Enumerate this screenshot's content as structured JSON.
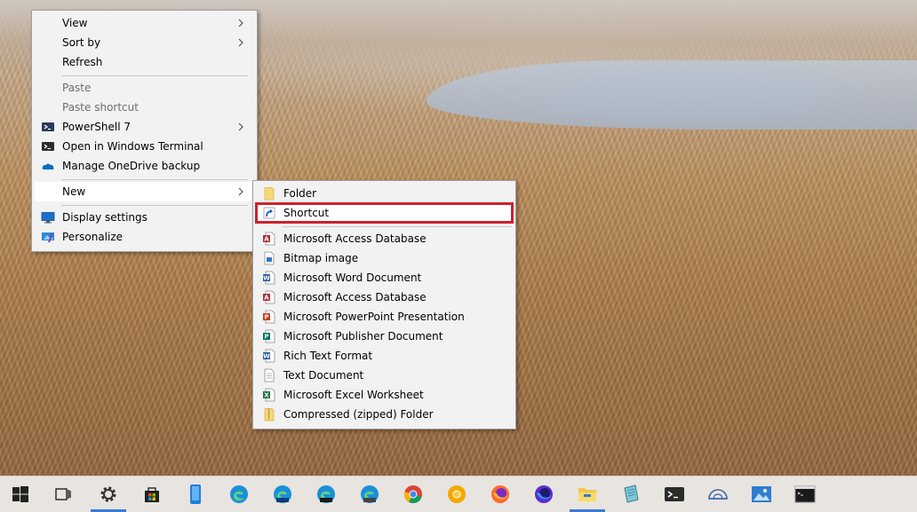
{
  "context_menu": {
    "view": "View",
    "sort_by": "Sort by",
    "refresh": "Refresh",
    "paste": "Paste",
    "paste_shortcut": "Paste shortcut",
    "powershell": "PowerShell 7",
    "open_terminal": "Open in Windows Terminal",
    "onedrive_backup": "Manage OneDrive backup",
    "new": "New",
    "display_settings": "Display settings",
    "personalize": "Personalize"
  },
  "new_submenu": {
    "folder": "Folder",
    "shortcut": "Shortcut",
    "items": [
      {
        "label": "Microsoft Access Database",
        "icon": "access-icon",
        "color": "#a4373a",
        "letter": "A"
      },
      {
        "label": "Bitmap image",
        "icon": "bitmap-icon",
        "color": "#2b79c2",
        "letter": ""
      },
      {
        "label": "Microsoft Word Document",
        "icon": "word-icon",
        "color": "#2b579a",
        "letter": "W"
      },
      {
        "label": "Microsoft Access Database",
        "icon": "access-icon",
        "color": "#a4373a",
        "letter": "A"
      },
      {
        "label": "Microsoft PowerPoint Presentation",
        "icon": "powerpoint-icon",
        "color": "#c43e1c",
        "letter": "P"
      },
      {
        "label": "Microsoft Publisher Document",
        "icon": "publisher-icon",
        "color": "#077568",
        "letter": "P"
      },
      {
        "label": "Rich Text Format",
        "icon": "wordpad-icon",
        "color": "#2b579a",
        "letter": "W"
      },
      {
        "label": "Text Document",
        "icon": "text-file-icon",
        "color": "",
        "letter": ""
      },
      {
        "label": "Microsoft Excel Worksheet",
        "icon": "excel-icon",
        "color": "#217346",
        "letter": "X"
      },
      {
        "label": "Compressed (zipped) Folder",
        "icon": "zip-folder-icon",
        "color": "#e8c04a",
        "letter": ""
      }
    ]
  },
  "colors": {
    "highlight": "#d0202c",
    "accent": "#3a7bd5"
  },
  "taskbar": [
    {
      "name": "start-button-icon",
      "active": false
    },
    {
      "name": "task-view-icon",
      "active": false
    },
    {
      "name": "settings-gear-icon",
      "active": true
    },
    {
      "name": "microsoft-store-icon",
      "active": false
    },
    {
      "name": "phone-app-icon",
      "active": false
    },
    {
      "name": "edge-icon",
      "active": false
    },
    {
      "name": "edge-beta-icon",
      "active": false
    },
    {
      "name": "edge-dev-icon",
      "active": false
    },
    {
      "name": "edge-canary-icon",
      "active": false
    },
    {
      "name": "chrome-icon",
      "active": false
    },
    {
      "name": "chrome-canary-icon",
      "active": false
    },
    {
      "name": "firefox-icon",
      "active": false
    },
    {
      "name": "firefox-nightly-icon",
      "active": false
    },
    {
      "name": "file-explorer-icon",
      "active": true
    },
    {
      "name": "notepad-icon",
      "active": false
    },
    {
      "name": "terminal-icon",
      "active": false
    },
    {
      "name": "paint-3d-icon",
      "active": false
    },
    {
      "name": "photos-icon",
      "active": false
    },
    {
      "name": "command-prompt-icon",
      "active": false
    }
  ]
}
